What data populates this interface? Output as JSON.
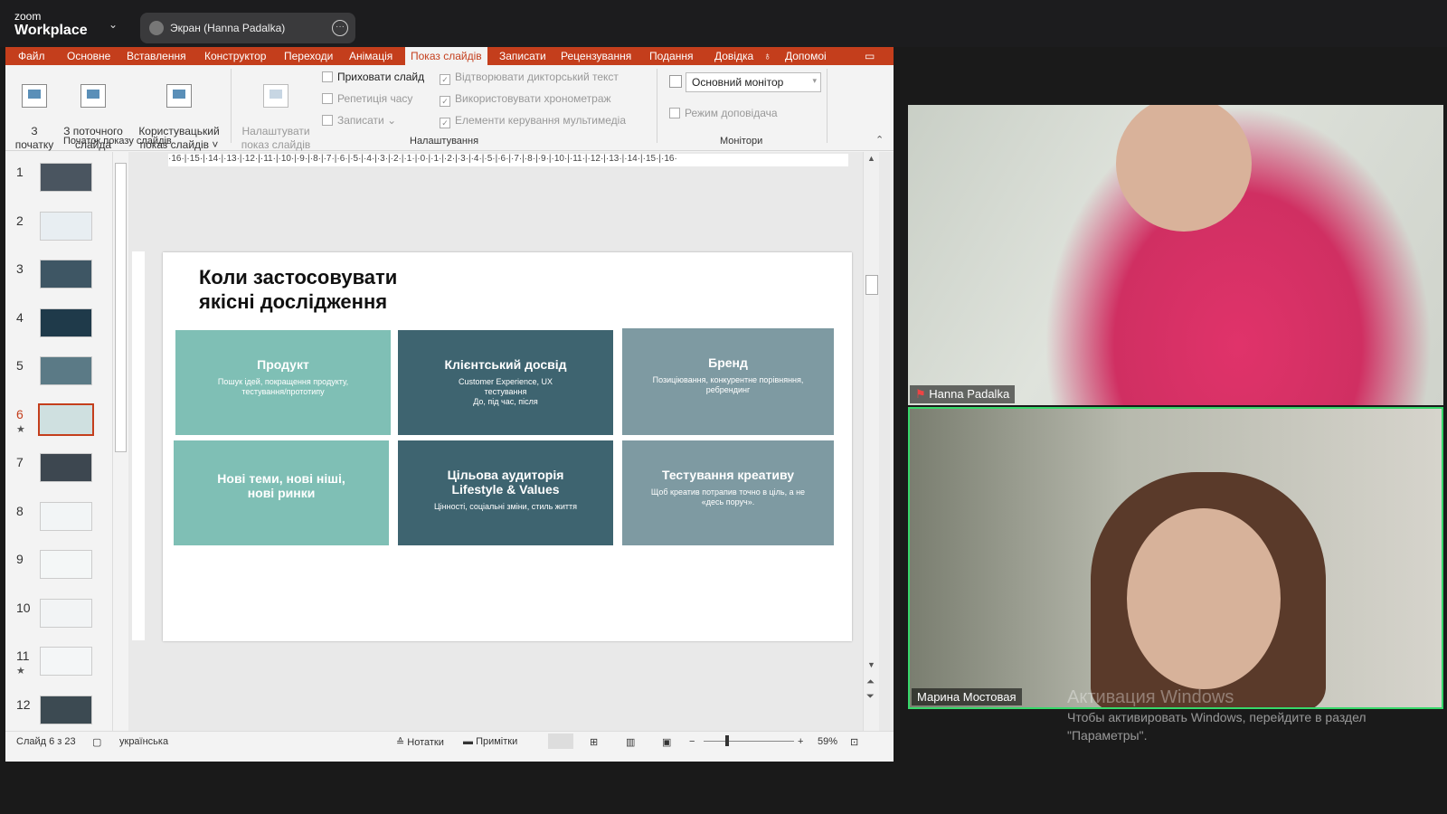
{
  "zoom": {
    "logo_top": "zoom",
    "logo_bottom": "Workplace",
    "share_label": "Экран (Hanna Padalka)"
  },
  "ribbon_tabs": [
    "Файл",
    "Основне",
    "Вставлення",
    "Конструктор",
    "Переходи",
    "Анімація",
    "Показ слайдів",
    "Записати",
    "Рецензування",
    "Подання",
    "Довідка",
    "Допомоі"
  ],
  "ribbon": {
    "from_start": "З\nпочатку",
    "from_current": "З поточного\nслайда",
    "custom_show": "Користувацький\nпоказ слайдів ˅",
    "setup_show": "Налаштувати\nпоказ слайдів",
    "hide_slide": "Приховати слайд",
    "rehearse": "Репетиція часу",
    "record": "Записати",
    "play_narration": "Відтворювати дикторський текст",
    "use_timings": "Використовувати хронометраж",
    "media_controls": "Елементи керування мультимедіа",
    "monitor_value": "Основний монітор",
    "presenter_view": "Режим доповідача",
    "group_start": "Початок показу слайдів",
    "group_setup": "Налаштування",
    "group_monitors": "Монітори"
  },
  "thumbnails": [
    {
      "num": "1",
      "star": "",
      "color": "#4a5560"
    },
    {
      "num": "2",
      "star": "",
      "color": "#e8eef2"
    },
    {
      "num": "3",
      "star": "",
      "color": "#3e5664"
    },
    {
      "num": "4",
      "star": "",
      "color": "#1f3a4a"
    },
    {
      "num": "5",
      "star": "",
      "color": "#5b7a86"
    },
    {
      "num": "6",
      "star": "★",
      "color": "#cfe0e0"
    },
    {
      "num": "7",
      "star": "",
      "color": "#3d4750"
    },
    {
      "num": "8",
      "star": "",
      "color": "#f2f5f6"
    },
    {
      "num": "9",
      "star": "",
      "color": "#f4f7f7"
    },
    {
      "num": "10",
      "star": "",
      "color": "#f2f4f5"
    },
    {
      "num": "11",
      "star": "★",
      "color": "#f4f6f7"
    },
    {
      "num": "12",
      "star": "",
      "color": "#3c4a52"
    }
  ],
  "ruler_text": "·16·|·15·|·14·|·13·|·12·|·11·|·10·|·9·|·8·|·7·|·6·|·5·|·4·|·3·|·2·|·1·|·0·|·1·|·2·|·3·|·4·|·5·|·6·|·7·|·8·|·9·|·10·|·11·|·12·|·13·|·14·|·15·|·16·",
  "slide": {
    "title": "Коли  застосовувати\nякісні дослідження",
    "cards": [
      {
        "title": "Продукт",
        "desc": "Пошук ідей, покращення продукту,\nтестування/прототипу",
        "color": "#7fbfb5"
      },
      {
        "title": "Клієнтський досвід",
        "desc": "Customer Experience, UX\nтестування\nДо, під час, після",
        "color": "#3e6470"
      },
      {
        "title": "Бренд",
        "desc": "Позиціювання, конкурентне порівняння,\nребрендинг",
        "color": "#7e9aa2"
      },
      {
        "title": "Нові теми, нові ніші,\nнові ринки",
        "desc": "",
        "color": "#7fbfb5"
      },
      {
        "title": "Цільова аудиторія\nLifestyle & Values",
        "desc": "Цінності, соціальні зміни,  стиль життя",
        "color": "#3e6470"
      },
      {
        "title": "Тестування креативу",
        "desc": "Щоб креатив потрапив точно в ціль, а не\n«десь поруч».",
        "color": "#7e9aa2"
      }
    ]
  },
  "status": {
    "slide_of": "Слайд 6 з 23",
    "language": "українська",
    "notes": "Нотатки",
    "comments": "Примітки",
    "zoom": "59%"
  },
  "participants": {
    "p1": "Hanna Padalka",
    "p2": "Марина Мостовая"
  },
  "activation": {
    "title": "Активация Windows",
    "text": "Чтобы активировать Windows, перейдите в раздел\n\"Параметры\"."
  }
}
